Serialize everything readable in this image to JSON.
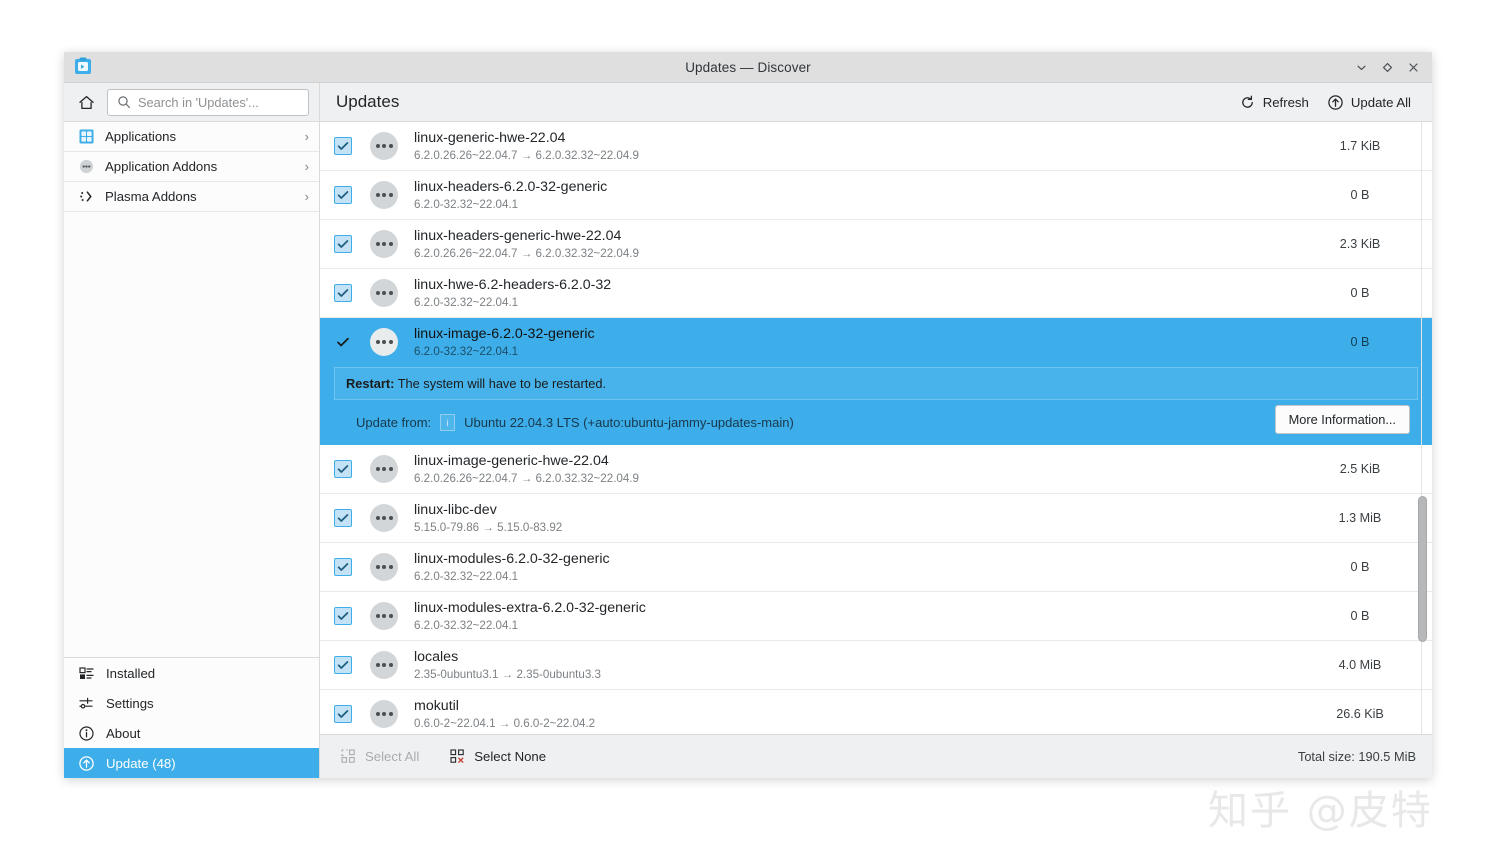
{
  "window": {
    "title": "Updates — Discover",
    "app_icon": "discover-icon",
    "controls": [
      {
        "name": "minimize",
        "glyph": "⌄"
      },
      {
        "name": "maximize",
        "glyph": "◇"
      },
      {
        "name": "close",
        "glyph": "✕"
      }
    ]
  },
  "sidebar": {
    "home_icon": "home-icon",
    "search": {
      "placeholder": "Search in 'Updates'...",
      "value": "",
      "icon": "search-icon"
    },
    "categories": [
      {
        "label": "Applications",
        "icon": "applications-grid-icon",
        "chevron": "›"
      },
      {
        "label": "Application Addons",
        "icon": "addons-dots-icon",
        "chevron": "›"
      },
      {
        "label": "Plasma Addons",
        "icon": "plasma-icon",
        "chevron": "›"
      }
    ],
    "bottom_items": [
      {
        "label": "Installed",
        "icon": "installed-list-icon",
        "active": false
      },
      {
        "label": "Settings",
        "icon": "settings-sliders-icon",
        "active": false
      },
      {
        "label": "About",
        "icon": "about-info-icon",
        "active": false
      },
      {
        "label": "Update (48)",
        "icon": "update-arrow-icon",
        "active": true
      }
    ]
  },
  "main": {
    "title": "Updates",
    "toolbar": {
      "refresh_label": "Refresh",
      "refresh_icon": "refresh-icon",
      "update_all_label": "Update All",
      "update_all_icon": "update-arrow-icon"
    }
  },
  "packages": [
    {
      "name": "linux-generic-hwe-22.04",
      "version": "6.2.0.26.26~22.04.7 → 6.2.0.32.32~22.04.9",
      "size": "1.7 KiB",
      "checked": true,
      "selected": false
    },
    {
      "name": "linux-headers-6.2.0-32-generic",
      "version": "6.2.0-32.32~22.04.1",
      "size": "0 B",
      "checked": true,
      "selected": false
    },
    {
      "name": "linux-headers-generic-hwe-22.04",
      "version": "6.2.0.26.26~22.04.7 → 6.2.0.32.32~22.04.9",
      "size": "2.3 KiB",
      "checked": true,
      "selected": false
    },
    {
      "name": "linux-hwe-6.2-headers-6.2.0-32",
      "version": "6.2.0-32.32~22.04.1",
      "size": "0 B",
      "checked": true,
      "selected": false
    },
    {
      "name": "linux-image-6.2.0-32-generic",
      "version": "6.2.0-32.32~22.04.1",
      "size": "0 B",
      "checked": true,
      "selected": true
    },
    {
      "name": "linux-image-generic-hwe-22.04",
      "version": "6.2.0.26.26~22.04.7 → 6.2.0.32.32~22.04.9",
      "size": "2.5 KiB",
      "checked": true,
      "selected": false
    },
    {
      "name": "linux-libc-dev",
      "version": "5.15.0-79.86 → 5.15.0-83.92",
      "size": "1.3 MiB",
      "checked": true,
      "selected": false
    },
    {
      "name": "linux-modules-6.2.0-32-generic",
      "version": "6.2.0-32.32~22.04.1",
      "size": "0 B",
      "checked": true,
      "selected": false
    },
    {
      "name": "linux-modules-extra-6.2.0-32-generic",
      "version": "6.2.0-32.32~22.04.1",
      "size": "0 B",
      "checked": true,
      "selected": false
    },
    {
      "name": "locales",
      "version": "2.35-0ubuntu3.1 → 2.35-0ubuntu3.3",
      "size": "4.0 MiB",
      "checked": true,
      "selected": false
    },
    {
      "name": "mokutil",
      "version": "0.6.0-2~22.04.1 → 0.6.0-2~22.04.2",
      "size": "26.6 KiB",
      "checked": true,
      "selected": false
    }
  ],
  "detail": {
    "restart_label": "Restart:",
    "restart_text": "The system will have to be restarted.",
    "origin_label": "Update from:",
    "origin_value": "Ubuntu 22.04.3 LTS (+auto:ubuntu-jammy-updates-main)",
    "more_info_label": "More Information..."
  },
  "footer": {
    "select_all_label": "Select All",
    "select_all_icon": "select-all-icon",
    "select_all_enabled": false,
    "select_none_label": "Select None",
    "select_none_icon": "select-none-icon",
    "total_size_label": "Total size: 190.5 MiB"
  },
  "watermark": {
    "text": "知乎 @皮特"
  },
  "colors": {
    "accent": "#3daee9",
    "titlebar": "#dfdfdf",
    "chrome": "#eff0f1",
    "text": "#232629",
    "muted": "#7d8184"
  }
}
